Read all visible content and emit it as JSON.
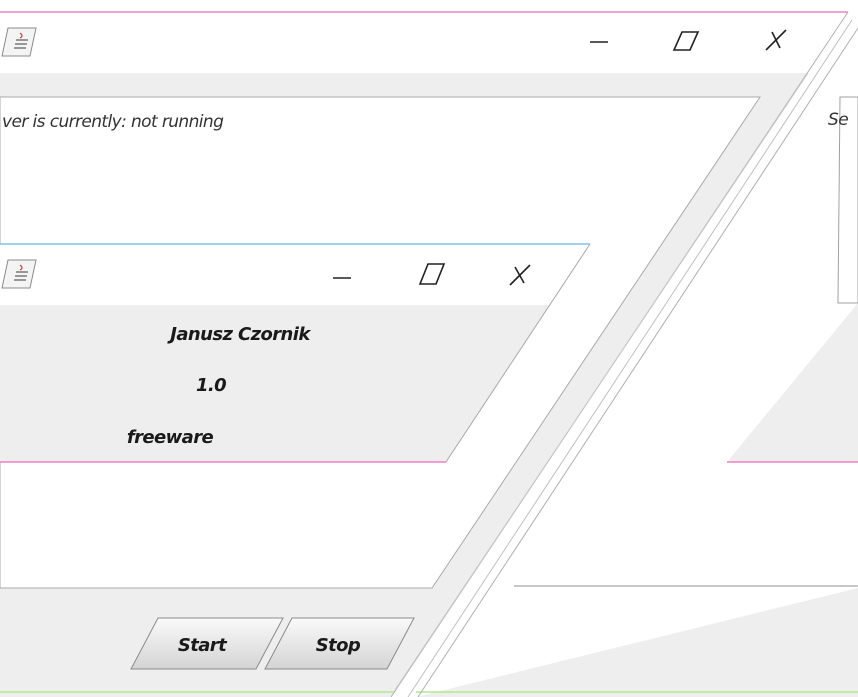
{
  "main_window": {
    "title_icon": "java-cup-icon",
    "controls": {
      "minimize": "minimize-icon",
      "maximize": "maximize-icon",
      "close": "close-icon"
    },
    "status_text": "ver is currently: not running",
    "start_label": "Start",
    "stop_label": "Stop"
  },
  "about_window": {
    "title_icon": "java-cup-icon",
    "controls": {
      "minimize": "minimize-icon",
      "maximize": "maximize-icon",
      "close": "close-icon"
    },
    "author": "Janusz Czornik",
    "version": "1.0",
    "license": "freeware"
  },
  "right_window": {
    "label_fragment": "Se"
  },
  "colors": {
    "main_border_top": "#f080c8",
    "main_border_bottom": "#b0e890",
    "about_border_top": "#80c0ee",
    "about_border_bottom": "#f080c8",
    "panel_gray": "#eeeeee",
    "outline": "#a0a0a0"
  }
}
